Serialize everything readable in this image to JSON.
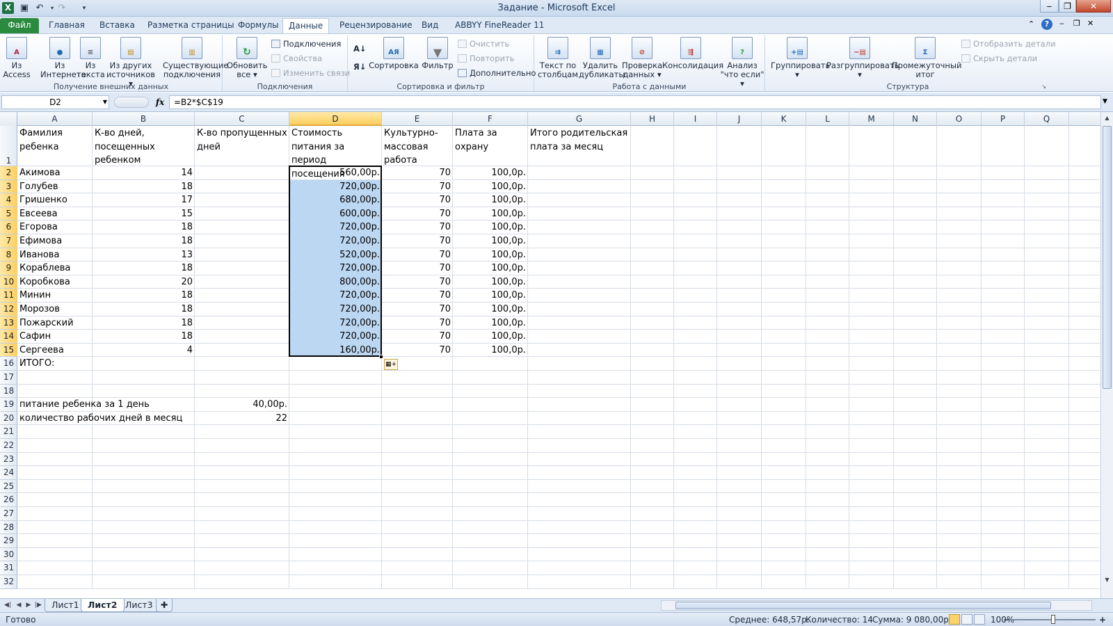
{
  "window": {
    "title": "Задание - Microsoft Excel",
    "app_icon": "X"
  },
  "quick_access": {
    "save_icon": "save-icon",
    "undo_icon": "undo-icon",
    "redo_icon": "redo-icon"
  },
  "tabs": [
    {
      "label": "Файл"
    },
    {
      "label": "Главная"
    },
    {
      "label": "Вставка"
    },
    {
      "label": "Разметка страницы"
    },
    {
      "label": "Формулы"
    },
    {
      "label": "Данные",
      "active": true
    },
    {
      "label": "Рецензирование"
    },
    {
      "label": "Вид"
    },
    {
      "label": "ABBYY FineReader 11"
    }
  ],
  "ribbon": {
    "groups": {
      "external": "Получение внешних данных",
      "connections": "Подключения",
      "sort_filter": "Сортировка и фильтр",
      "data_tools": "Работа с данными",
      "outline": "Структура"
    },
    "buttons": {
      "from_access": [
        "Из",
        "Access"
      ],
      "from_web": [
        "Из",
        "Интернета"
      ],
      "from_text": [
        "Из",
        "текста"
      ],
      "from_other": [
        "Из других",
        "источников ▾"
      ],
      "existing": [
        "Существующие",
        "подключения"
      ],
      "refresh_all": [
        "Обновить",
        "все ▾"
      ],
      "connections": "Подключения",
      "properties": "Свойства",
      "edit_links": "Изменить связи",
      "sort": "Сортировка",
      "filter": "Фильтр",
      "clear": "Очистить",
      "reapply": "Повторить",
      "advanced": "Дополнительно",
      "text_to_columns": [
        "Текст по",
        "столбцам"
      ],
      "remove_duplicates": [
        "Удалить",
        "дубликаты"
      ],
      "data_validation": [
        "Проверка",
        "данных ▾"
      ],
      "consolidate": "Консолидация",
      "what_if": [
        "Анализ",
        "\"что если\" ▾"
      ],
      "group": [
        "Группировать",
        "▾"
      ],
      "ungroup": [
        "Разгруппировать",
        "▾"
      ],
      "subtotal": [
        "Промежуточный",
        "итог"
      ],
      "show_detail": "Отобразить детали",
      "hide_detail": "Скрыть детали"
    }
  },
  "formula_bar": {
    "name_box": "D2",
    "fx": "fx",
    "formula": "=B2*$C$19"
  },
  "columns": [
    "A",
    "B",
    "C",
    "D",
    "E",
    "F",
    "G",
    "H",
    "I",
    "J",
    "K",
    "L",
    "M",
    "N",
    "O",
    "P",
    "Q"
  ],
  "selected_column": "D",
  "headers_row1": {
    "A": "Фамилия ребенка",
    "B": "К-во дней, посещенных ребенком",
    "C": "К-во пропущенных дней",
    "D": "Стоимость питания за период посещения",
    "E": "Культурно-массовая работа",
    "F": "Плата за охрану",
    "G": "Итого родительская плата за месяц"
  },
  "table": [
    {
      "row": 2,
      "name": "Акимова",
      "days": "14",
      "cost": "560,00р.",
      "cultural": "70",
      "security": "100,0р."
    },
    {
      "row": 3,
      "name": "Голубев",
      "days": "18",
      "cost": "720,00р.",
      "cultural": "70",
      "security": "100,0р."
    },
    {
      "row": 4,
      "name": "Гришенко",
      "days": "17",
      "cost": "680,00р.",
      "cultural": "70",
      "security": "100,0р."
    },
    {
      "row": 5,
      "name": "Евсеева",
      "days": "15",
      "cost": "600,00р.",
      "cultural": "70",
      "security": "100,0р."
    },
    {
      "row": 6,
      "name": "Егорова",
      "days": "18",
      "cost": "720,00р.",
      "cultural": "70",
      "security": "100,0р."
    },
    {
      "row": 7,
      "name": "Ефимова",
      "days": "18",
      "cost": "720,00р.",
      "cultural": "70",
      "security": "100,0р."
    },
    {
      "row": 8,
      "name": "Иванова",
      "days": "13",
      "cost": "520,00р.",
      "cultural": "70",
      "security": "100,0р."
    },
    {
      "row": 9,
      "name": "Кораблева",
      "days": "18",
      "cost": "720,00р.",
      "cultural": "70",
      "security": "100,0р."
    },
    {
      "row": 10,
      "name": "Коробкова",
      "days": "20",
      "cost": "800,00р.",
      "cultural": "70",
      "security": "100,0р."
    },
    {
      "row": 11,
      "name": "Минин",
      "days": "18",
      "cost": "720,00р.",
      "cultural": "70",
      "security": "100,0р."
    },
    {
      "row": 12,
      "name": "Морозов",
      "days": "18",
      "cost": "720,00р.",
      "cultural": "70",
      "security": "100,0р."
    },
    {
      "row": 13,
      "name": "Пожарский",
      "days": "18",
      "cost": "720,00р.",
      "cultural": "70",
      "security": "100,0р."
    },
    {
      "row": 14,
      "name": "Сафин",
      "days": "18",
      "cost": "720,00р.",
      "cultural": "70",
      "security": "100,0р."
    },
    {
      "row": 15,
      "name": "Сергеева",
      "days": "4",
      "cost": "160,00р.",
      "cultural": "70",
      "security": "100,0р."
    }
  ],
  "extra": {
    "total_label": "ИТОГО:",
    "daily_meal_label": "питание ребенка за 1 день",
    "daily_meal_value": "40,00р.",
    "workdays_label": "количество рабочих дней в месяц",
    "workdays_value": "22"
  },
  "row_numbers": [
    "1",
    "2",
    "3",
    "4",
    "5",
    "6",
    "7",
    "8",
    "9",
    "10",
    "11",
    "12",
    "13",
    "14",
    "15",
    "16",
    "17",
    "18",
    "19",
    "20",
    "21",
    "22",
    "23",
    "24",
    "25",
    "26",
    "27",
    "28",
    "29",
    "30",
    "31",
    "32"
  ],
  "sheets": [
    {
      "label": "Лист1"
    },
    {
      "label": "Лист2",
      "active": true
    },
    {
      "label": "Лист3"
    }
  ],
  "status": {
    "ready": "Готово",
    "average": "Среднее: 648,57р.",
    "count": "Количество: 14",
    "sum": "Сумма: 9 080,00р.",
    "zoom": "100%"
  }
}
